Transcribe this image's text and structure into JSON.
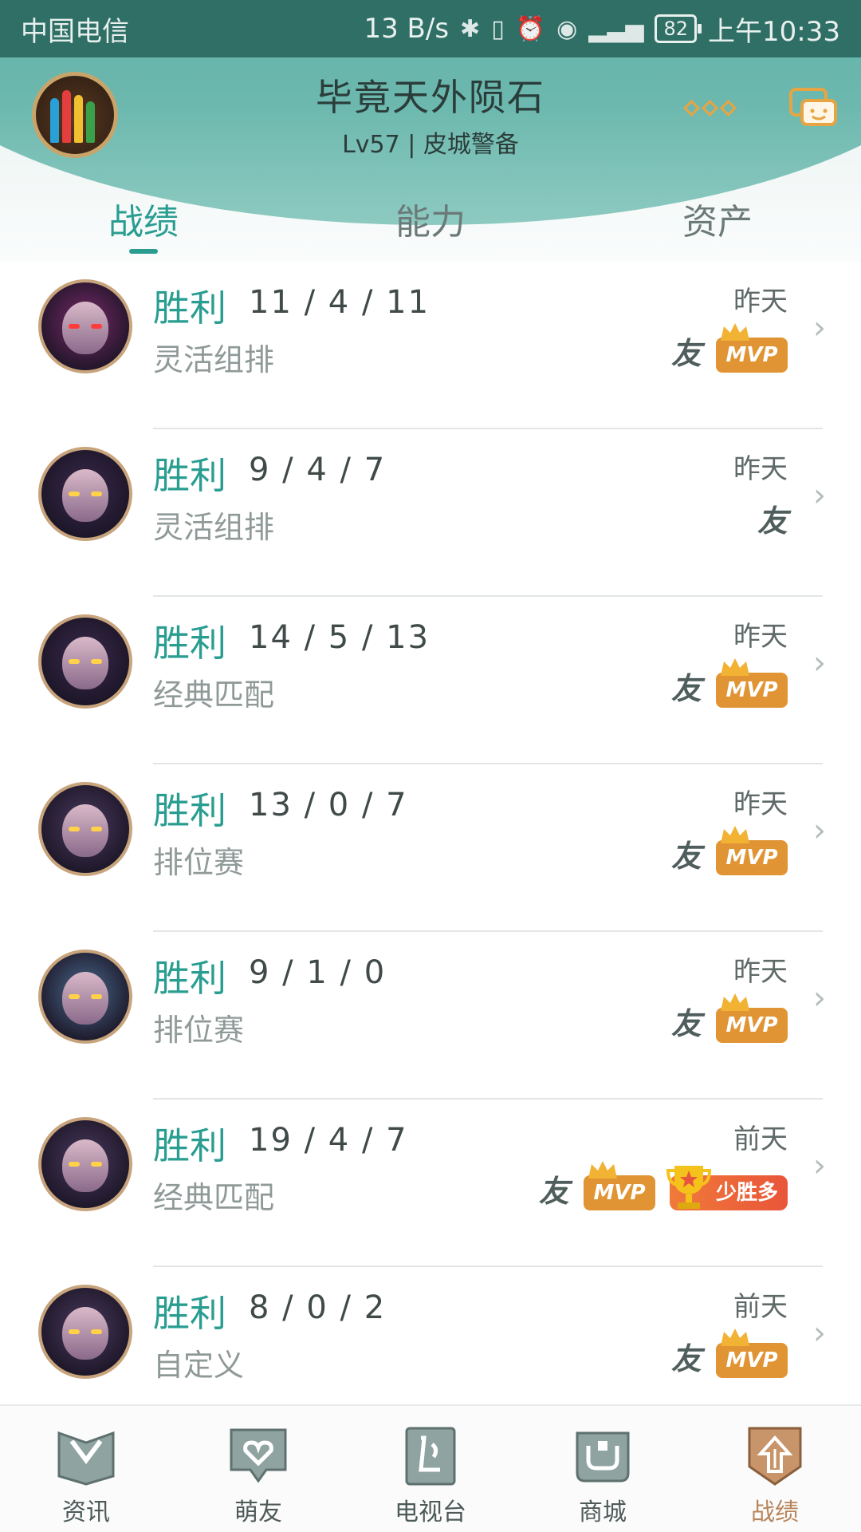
{
  "status_bar": {
    "carrier": "中国电信",
    "speed": "13 B/s",
    "battery": "82",
    "time": "上午10:33"
  },
  "header": {
    "username": "毕竟天外陨石",
    "level": "Lv57 | 皮城警备",
    "tabs": [
      {
        "label": "战绩",
        "active": true
      },
      {
        "label": "能力",
        "active": false
      },
      {
        "label": "资产",
        "active": false
      }
    ]
  },
  "matches": [
    {
      "result": "胜利",
      "kda": "11 / 4 / 11",
      "mode": "灵活组排",
      "date": "昨天",
      "friend": "友",
      "mvp": "MVP",
      "hero_color": "#7a2a6a"
    },
    {
      "result": "胜利",
      "kda": "9 / 4 / 7",
      "mode": "灵活组排",
      "date": "昨天",
      "friend": "友",
      "hero_color": "#3a2a4e"
    },
    {
      "result": "胜利",
      "kda": "14 / 5 / 13",
      "mode": "经典匹配",
      "date": "昨天",
      "friend": "友",
      "mvp": "MVP",
      "hero_color": "#3a2a4e"
    },
    {
      "result": "胜利",
      "kda": "13 / 0 / 7",
      "mode": "排位赛",
      "date": "昨天",
      "friend": "友",
      "mvp": "MVP",
      "hero_color": "#4a3a5e"
    },
    {
      "result": "胜利",
      "kda": "9 / 1 / 0",
      "mode": "排位赛",
      "date": "昨天",
      "friend": "友",
      "mvp": "MVP",
      "hero_color": "#4a6a8e"
    },
    {
      "result": "胜利",
      "kda": "19 / 4 / 7",
      "mode": "经典匹配",
      "date": "前天",
      "friend": "友",
      "mvp": "MVP",
      "streak": "少胜多",
      "hero_color": "#4a3a5e"
    },
    {
      "result": "胜利",
      "kda": "8 / 0 / 2",
      "mode": "自定义",
      "date": "前天",
      "friend": "友",
      "mvp": "MVP",
      "hero_color": "#4a3a5e"
    }
  ],
  "bottom_nav": [
    {
      "label": "资讯",
      "icon": "book-icon",
      "active": false
    },
    {
      "label": "萌友",
      "icon": "heart-chat-icon",
      "active": false
    },
    {
      "label": "电视台",
      "icon": "tv-icon",
      "active": false
    },
    {
      "label": "商城",
      "icon": "shop-icon",
      "active": false
    },
    {
      "label": "战绩",
      "icon": "record-icon",
      "active": true
    }
  ],
  "colors": {
    "accent": "#2a9d91",
    "mvp": "#e09433",
    "active_nav": "#b8845a"
  }
}
